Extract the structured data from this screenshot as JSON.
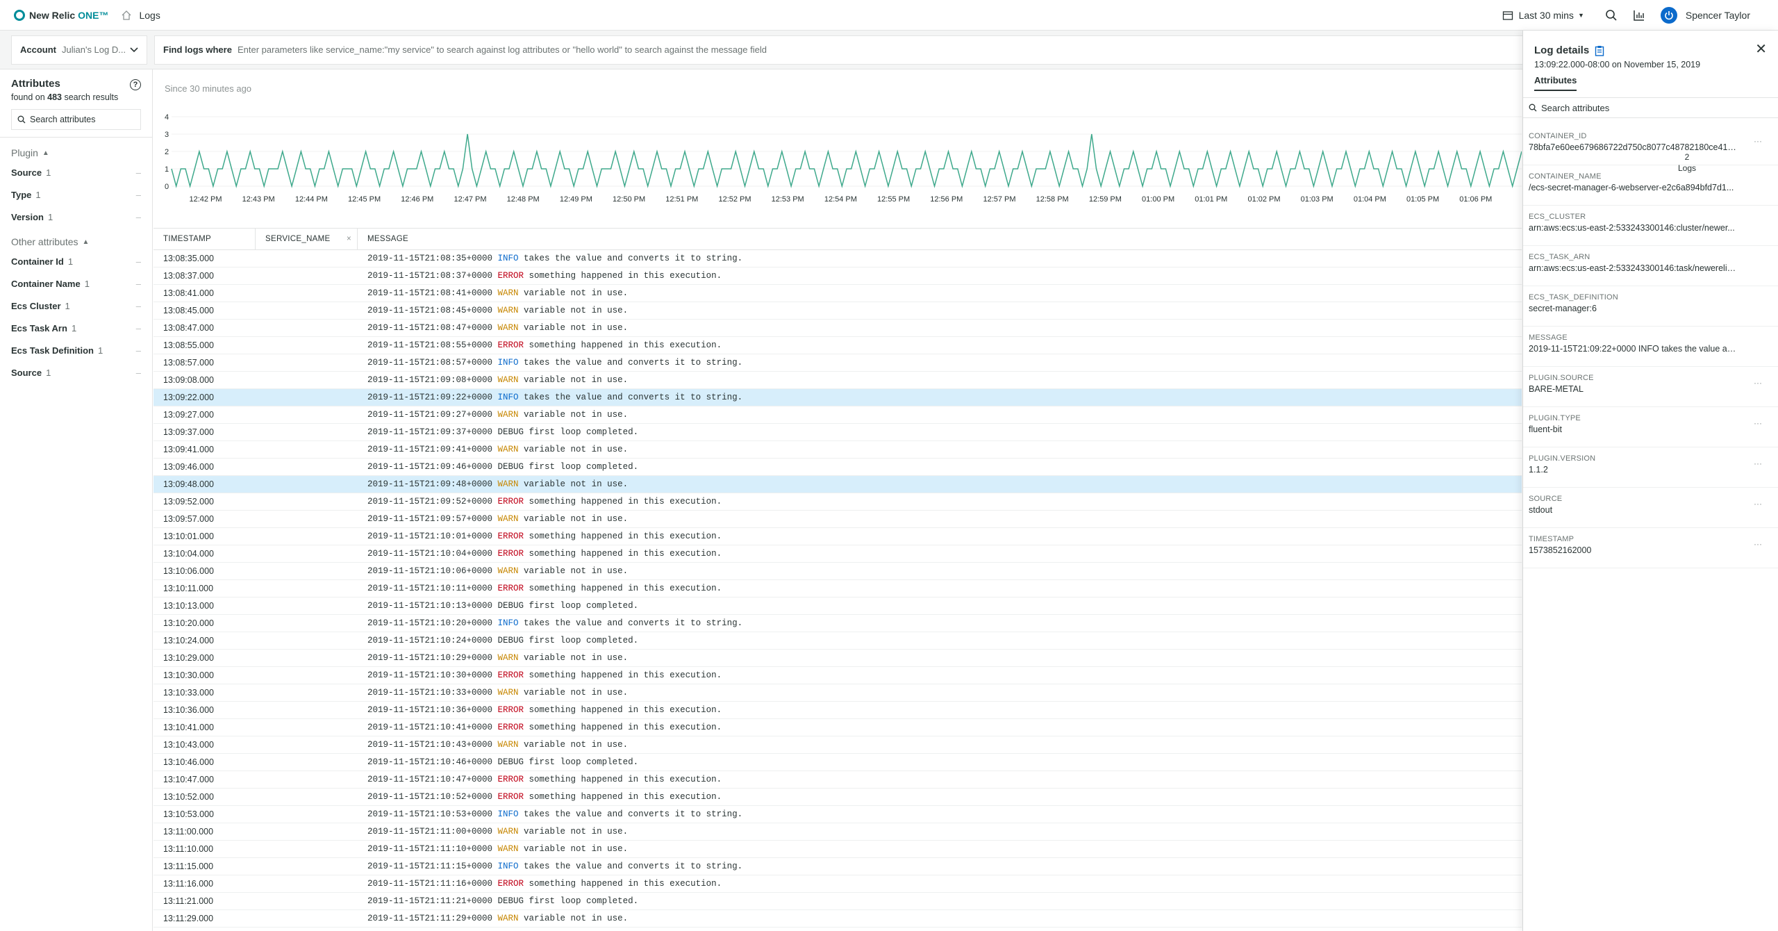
{
  "header": {
    "brand": "New Relic",
    "brand_suffix": "ONE™",
    "breadcrumb": "Logs",
    "time_range": "Last 30 mins",
    "user_name": "Spencer Taylor"
  },
  "search": {
    "account_label": "Account",
    "account_value": "Julian's Log D...",
    "find_label": "Find logs where",
    "placeholder": "Enter parameters like service_name:\"my service\" to search against log attributes or \"hello world\" to search against the message field"
  },
  "sidebar": {
    "title": "Attributes",
    "found_prefix": "found on ",
    "found_count": "483",
    "found_suffix": " search results",
    "search_placeholder": "Search attributes",
    "plugin_group": "Plugin",
    "plugin_items": [
      {
        "name": "Source",
        "count": "1"
      },
      {
        "name": "Type",
        "count": "1"
      },
      {
        "name": "Version",
        "count": "1"
      }
    ],
    "other_group": "Other attributes",
    "other_items": [
      {
        "name": "Container Id",
        "count": "1"
      },
      {
        "name": "Container Name",
        "count": "1"
      },
      {
        "name": "Ecs Cluster",
        "count": "1"
      },
      {
        "name": "Ecs Task Arn",
        "count": "1"
      },
      {
        "name": "Ecs Task Definition",
        "count": "1"
      },
      {
        "name": "Source",
        "count": "1"
      }
    ]
  },
  "chart": {
    "since": "Since 30 minutes ago"
  },
  "chart_data": {
    "type": "line",
    "yticks": [
      "4",
      "3",
      "2",
      "1",
      "0"
    ],
    "ylim": [
      0,
      4
    ],
    "xticks": [
      "12:42 PM",
      "12:43 PM",
      "12:44 PM",
      "12:45 PM",
      "12:46 PM",
      "12:47 PM",
      "12:48 PM",
      "12:49 PM",
      "12:50 PM",
      "12:51 PM",
      "12:52 PM",
      "12:53 PM",
      "12:54 PM",
      "12:55 PM",
      "12:56 PM",
      "12:57 PM",
      "12:58 PM",
      "12:59 PM",
      "01:00 PM",
      "01:01 PM",
      "01:02 PM",
      "01:03 PM",
      "01:04 PM",
      "01:05 PM",
      "01:06 PM"
    ],
    "series": [
      {
        "values": [
          1,
          0,
          1,
          1,
          0,
          1,
          2,
          1,
          1,
          0,
          1,
          1,
          2,
          1,
          0,
          1,
          1,
          2,
          1,
          1,
          0,
          1,
          1,
          1,
          2,
          1,
          0,
          1,
          2,
          1,
          1,
          0,
          1,
          1,
          2,
          1,
          0,
          1,
          1,
          1,
          0,
          1,
          2,
          1,
          1,
          0,
          1,
          1,
          2,
          1,
          0,
          1,
          1,
          1,
          2,
          1,
          0,
          1,
          1,
          2,
          1,
          1,
          0,
          1,
          3,
          1,
          0,
          1,
          2,
          1,
          1,
          0,
          1,
          1,
          2,
          1,
          0,
          1,
          1,
          2,
          1,
          1,
          0,
          1,
          2,
          1,
          1,
          0,
          1,
          1,
          2,
          1,
          0,
          1,
          1,
          1,
          2,
          1,
          0,
          1,
          2,
          1,
          1,
          0,
          1,
          2,
          1,
          1,
          0,
          1,
          1,
          2,
          1,
          0,
          1,
          1,
          2,
          1,
          0,
          1,
          1,
          1,
          2,
          1,
          0,
          1,
          2,
          1,
          1,
          0,
          1,
          1,
          2,
          1,
          0,
          1,
          1,
          2,
          1,
          1,
          0,
          1,
          2,
          1,
          1,
          0,
          1,
          1,
          2,
          1,
          0,
          1,
          1,
          2,
          1,
          0,
          1,
          2,
          1,
          1,
          0,
          1,
          1,
          2,
          1,
          0,
          1,
          1,
          2,
          1,
          1,
          0,
          1,
          2,
          1,
          1,
          0,
          1,
          1,
          2,
          1,
          0,
          1,
          1,
          2,
          1,
          0,
          1,
          1,
          1,
          2,
          1,
          0,
          1,
          2,
          1,
          1,
          0,
          1,
          3,
          1,
          0,
          1,
          2,
          1,
          0,
          1,
          1,
          2,
          1,
          0,
          1,
          1,
          2,
          1,
          1,
          0,
          1,
          2,
          1,
          1,
          0,
          1,
          1,
          2,
          1,
          0,
          1,
          1,
          2,
          1,
          0,
          1,
          2,
          1,
          1,
          0,
          1,
          1,
          2,
          1,
          0,
          1,
          1,
          2,
          1,
          1,
          0,
          1,
          2,
          1,
          0,
          1,
          1,
          2,
          1,
          0,
          1,
          1,
          2,
          1,
          1,
          0,
          1,
          2,
          1,
          1,
          0,
          1,
          2,
          1,
          0,
          1,
          1,
          2,
          1,
          0,
          1,
          2,
          1,
          1,
          0,
          1,
          2,
          1,
          0,
          1,
          1,
          2,
          1,
          0,
          1,
          2
        ]
      }
    ],
    "color": "#3fa98c"
  },
  "table": {
    "headers": {
      "timestamp": "TIMESTAMP",
      "service": "SERVICE_NAME",
      "message": "MESSAGE"
    },
    "rows": [
      {
        "ts": "13:08:35.000",
        "pre": "2019-11-15T21:08:35+0000 ",
        "level": "INFO",
        "text": " takes the value and converts it to string."
      },
      {
        "ts": "13:08:37.000",
        "pre": "2019-11-15T21:08:37+0000 ",
        "level": "ERROR",
        "text": " something happened in this execution."
      },
      {
        "ts": "13:08:41.000",
        "pre": "2019-11-15T21:08:41+0000 ",
        "level": "WARN",
        "text": " variable not in use."
      },
      {
        "ts": "13:08:45.000",
        "pre": "2019-11-15T21:08:45+0000 ",
        "level": "WARN",
        "text": " variable not in use."
      },
      {
        "ts": "13:08:47.000",
        "pre": "2019-11-15T21:08:47+0000 ",
        "level": "WARN",
        "text": " variable not in use."
      },
      {
        "ts": "13:08:55.000",
        "pre": "2019-11-15T21:08:55+0000 ",
        "level": "ERROR",
        "text": " something happened in this execution."
      },
      {
        "ts": "13:08:57.000",
        "pre": "2019-11-15T21:08:57+0000 ",
        "level": "INFO",
        "text": " takes the value and converts it to string."
      },
      {
        "ts": "13:09:08.000",
        "pre": "2019-11-15T21:09:08+0000 ",
        "level": "WARN",
        "text": " variable not in use."
      },
      {
        "ts": "13:09:22.000",
        "pre": "2019-11-15T21:09:22+0000 ",
        "level": "INFO",
        "text": " takes the value and converts it to string.",
        "selected": true
      },
      {
        "ts": "13:09:27.000",
        "pre": "2019-11-15T21:09:27+0000 ",
        "level": "WARN",
        "text": " variable not in use."
      },
      {
        "ts": "13:09:37.000",
        "pre": "2019-11-15T21:09:37+0000 ",
        "level": "DEBUG",
        "text": " first loop completed."
      },
      {
        "ts": "13:09:41.000",
        "pre": "2019-11-15T21:09:41+0000 ",
        "level": "WARN",
        "text": " variable not in use."
      },
      {
        "ts": "13:09:46.000",
        "pre": "2019-11-15T21:09:46+0000 ",
        "level": "DEBUG",
        "text": " first loop completed."
      },
      {
        "ts": "13:09:48.000",
        "pre": "2019-11-15T21:09:48+0000 ",
        "level": "WARN",
        "text": " variable not in use.",
        "selected": true
      },
      {
        "ts": "13:09:52.000",
        "pre": "2019-11-15T21:09:52+0000 ",
        "level": "ERROR",
        "text": " something happened in this execution."
      },
      {
        "ts": "13:09:57.000",
        "pre": "2019-11-15T21:09:57+0000 ",
        "level": "WARN",
        "text": " variable not in use."
      },
      {
        "ts": "13:10:01.000",
        "pre": "2019-11-15T21:10:01+0000 ",
        "level": "ERROR",
        "text": " something happened in this execution."
      },
      {
        "ts": "13:10:04.000",
        "pre": "2019-11-15T21:10:04+0000 ",
        "level": "ERROR",
        "text": " something happened in this execution."
      },
      {
        "ts": "13:10:06.000",
        "pre": "2019-11-15T21:10:06+0000 ",
        "level": "WARN",
        "text": " variable not in use."
      },
      {
        "ts": "13:10:11.000",
        "pre": "2019-11-15T21:10:11+0000 ",
        "level": "ERROR",
        "text": " something happened in this execution."
      },
      {
        "ts": "13:10:13.000",
        "pre": "2019-11-15T21:10:13+0000 ",
        "level": "DEBUG",
        "text": " first loop completed."
      },
      {
        "ts": "13:10:20.000",
        "pre": "2019-11-15T21:10:20+0000 ",
        "level": "INFO",
        "text": " takes the value and converts it to string."
      },
      {
        "ts": "13:10:24.000",
        "pre": "2019-11-15T21:10:24+0000 ",
        "level": "DEBUG",
        "text": " first loop completed."
      },
      {
        "ts": "13:10:29.000",
        "pre": "2019-11-15T21:10:29+0000 ",
        "level": "WARN",
        "text": " variable not in use."
      },
      {
        "ts": "13:10:30.000",
        "pre": "2019-11-15T21:10:30+0000 ",
        "level": "ERROR",
        "text": " something happened in this execution."
      },
      {
        "ts": "13:10:33.000",
        "pre": "2019-11-15T21:10:33+0000 ",
        "level": "WARN",
        "text": " variable not in use."
      },
      {
        "ts": "13:10:36.000",
        "pre": "2019-11-15T21:10:36+0000 ",
        "level": "ERROR",
        "text": " something happened in this execution."
      },
      {
        "ts": "13:10:41.000",
        "pre": "2019-11-15T21:10:41+0000 ",
        "level": "ERROR",
        "text": " something happened in this execution."
      },
      {
        "ts": "13:10:43.000",
        "pre": "2019-11-15T21:10:43+0000 ",
        "level": "WARN",
        "text": " variable not in use."
      },
      {
        "ts": "13:10:46.000",
        "pre": "2019-11-15T21:10:46+0000 ",
        "level": "DEBUG",
        "text": " first loop completed."
      },
      {
        "ts": "13:10:47.000",
        "pre": "2019-11-15T21:10:47+0000 ",
        "level": "ERROR",
        "text": " something happened in this execution."
      },
      {
        "ts": "13:10:52.000",
        "pre": "2019-11-15T21:10:52+0000 ",
        "level": "ERROR",
        "text": " something happened in this execution."
      },
      {
        "ts": "13:10:53.000",
        "pre": "2019-11-15T21:10:53+0000 ",
        "level": "INFO",
        "text": " takes the value and converts it to string."
      },
      {
        "ts": "13:11:00.000",
        "pre": "2019-11-15T21:11:00+0000 ",
        "level": "WARN",
        "text": " variable not in use."
      },
      {
        "ts": "13:11:10.000",
        "pre": "2019-11-15T21:11:10+0000 ",
        "level": "WARN",
        "text": " variable not in use."
      },
      {
        "ts": "13:11:15.000",
        "pre": "2019-11-15T21:11:15+0000 ",
        "level": "INFO",
        "text": " takes the value and converts it to string."
      },
      {
        "ts": "13:11:16.000",
        "pre": "2019-11-15T21:11:16+0000 ",
        "level": "ERROR",
        "text": " something happened in this execution."
      },
      {
        "ts": "13:11:21.000",
        "pre": "2019-11-15T21:11:21+0000 ",
        "level": "DEBUG",
        "text": " first loop completed."
      },
      {
        "ts": "13:11:29.000",
        "pre": "2019-11-15T21:11:29+0000 ",
        "level": "WARN",
        "text": " variable not in use."
      }
    ]
  },
  "panel": {
    "title": "Log details",
    "time": "13:09:22.000-08:00 on November 15, 2019",
    "tab": "Attributes",
    "search_placeholder": "Search attributes",
    "tooltip_count": "2",
    "tooltip_label": "Logs",
    "attributes": [
      {
        "key": "CONTAINER_ID",
        "value": "78bfa7e60ee679686722d750c8077c48782180ce41ff...",
        "more": true
      },
      {
        "key": "CONTAINER_NAME",
        "value": "/ecs-secret-manager-6-webserver-e2c6a894bfd7d1...",
        "more": false
      },
      {
        "key": "ECS_CLUSTER",
        "value": "arn:aws:ecs:us-east-2:533243300146:cluster/newer...",
        "more": false
      },
      {
        "key": "ECS_TASK_ARN",
        "value": "arn:aws:ecs:us-east-2:533243300146:task/newerelic...",
        "more": false
      },
      {
        "key": "ECS_TASK_DEFINITION",
        "value": "secret-manager:6",
        "more": false
      },
      {
        "key": "MESSAGE",
        "value": "2019-11-15T21:09:22+0000 INFO takes the value an...",
        "more": false
      },
      {
        "key": "PLUGIN.SOURCE",
        "value": "BARE-METAL",
        "more": true
      },
      {
        "key": "PLUGIN.TYPE",
        "value": "fluent-bit",
        "more": true
      },
      {
        "key": "PLUGIN.VERSION",
        "value": "1.1.2",
        "more": true
      },
      {
        "key": "SOURCE",
        "value": "stdout",
        "more": true
      },
      {
        "key": "TIMESTAMP",
        "value": "1573852162000",
        "more": true
      }
    ]
  }
}
